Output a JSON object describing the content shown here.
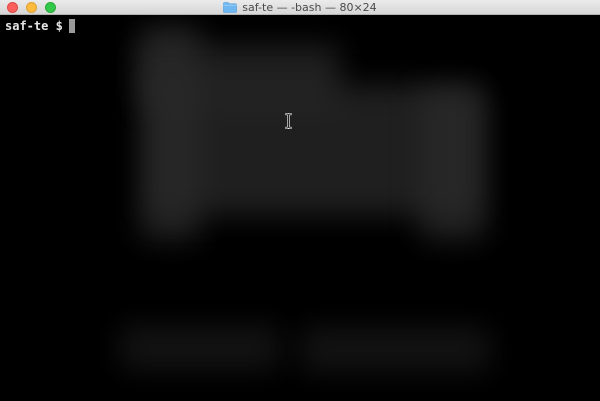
{
  "window": {
    "title": "saf-te — -bash — 80×24",
    "folder_icon": "folder-icon",
    "controls": {
      "close": "close-button",
      "minimize": "minimize-button",
      "zoom": "zoom-button"
    }
  },
  "terminal": {
    "prompt": "saf-te $",
    "cursor_icon": "text-cursor-icon"
  },
  "colors": {
    "background": "#000000",
    "prompt_text": "#e6e6e6",
    "folder": "#6fb7f0"
  }
}
